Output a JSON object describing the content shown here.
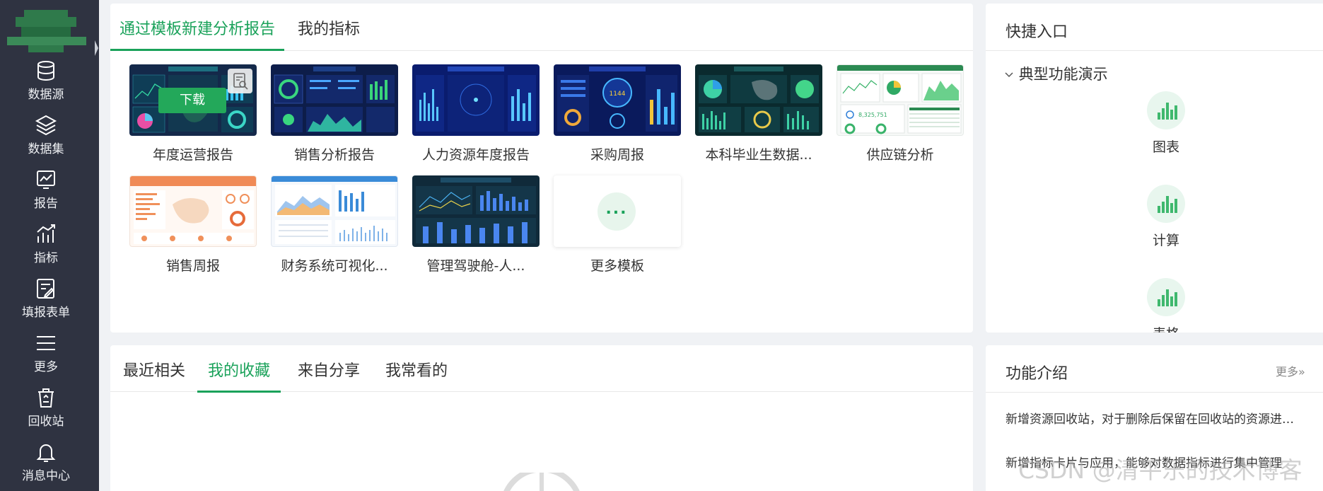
{
  "sidebar": {
    "items": [
      {
        "label": "数据源",
        "icon": "database-icon"
      },
      {
        "label": "数据集",
        "icon": "layers-icon"
      },
      {
        "label": "报告",
        "icon": "report-icon"
      },
      {
        "label": "指标",
        "icon": "metric-icon"
      },
      {
        "label": "填报表单",
        "icon": "form-edit-icon"
      },
      {
        "label": "更多",
        "icon": "menu-icon"
      },
      {
        "label": "回收站",
        "icon": "recycle-bin-icon"
      },
      {
        "label": "消息中心",
        "icon": "bell-icon"
      }
    ]
  },
  "templates_panel": {
    "tabs": [
      "通过模板新建分析报告",
      "我的指标"
    ],
    "active_tab": 0,
    "download_label": "下载",
    "templates": [
      {
        "name": "年度运营报告"
      },
      {
        "name": "销售分析报告"
      },
      {
        "name": "人力资源年度报告"
      },
      {
        "name": "采购周报"
      },
      {
        "name": "本科毕业生数据..."
      },
      {
        "name": "供应链分析"
      },
      {
        "name": "销售周报"
      },
      {
        "name": "财务系统可视化..."
      },
      {
        "name": "管理驾驶舱-人..."
      },
      {
        "name": "更多模板"
      }
    ],
    "more_dots": "..."
  },
  "recent_panel": {
    "tabs": [
      "最近相关",
      "我的收藏",
      "来自分享",
      "我常看的"
    ],
    "active_tab": 1
  },
  "quick_panel": {
    "title": "快捷入口",
    "group_title": "典型功能演示",
    "items": [
      {
        "label": "图表"
      },
      {
        "label": "计算"
      },
      {
        "label": "表格"
      }
    ]
  },
  "func_panel": {
    "title": "功能介绍",
    "more": "更多",
    "news": [
      "新增资源回收站，对于删除后保留在回收站的资源进行统一管理",
      "新增指标卡片与应用，能够对数据指标进行集中管理"
    ]
  },
  "watermark": "CSDN @清平乐的技术博客",
  "colors": {
    "accent": "#1aa25a",
    "sidebar": "#2f3341"
  }
}
